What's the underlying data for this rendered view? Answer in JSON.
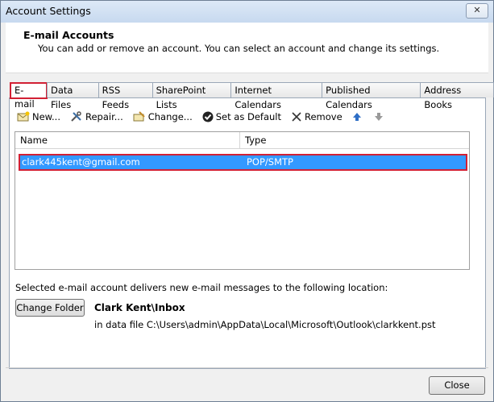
{
  "window": {
    "title": "Account Settings",
    "close_glyph": "✕"
  },
  "header": {
    "title": "E-mail Accounts",
    "subtitle": "You can add or remove an account. You can select an account and change its settings."
  },
  "tabs": [
    {
      "label": "E-mail"
    },
    {
      "label": "Data Files"
    },
    {
      "label": "RSS Feeds"
    },
    {
      "label": "SharePoint Lists"
    },
    {
      "label": "Internet Calendars"
    },
    {
      "label": "Published Calendars"
    },
    {
      "label": "Address Books"
    }
  ],
  "toolbar": {
    "new_label": "New...",
    "repair_label": "Repair...",
    "change_label": "Change...",
    "default_label": "Set as Default",
    "remove_label": "Remove"
  },
  "list": {
    "columns": {
      "name": "Name",
      "type": "Type"
    },
    "rows": [
      {
        "name": "clark445kent@gmail.com",
        "type": "POP/SMTP"
      }
    ]
  },
  "delivery": {
    "info": "Selected e-mail account delivers new e-mail messages to the following location:",
    "change_folder_label": "Change Folder",
    "location_name": "Clark Kent\\Inbox",
    "location_path": "in data file C:\\Users\\admin\\AppData\\Local\\Microsoft\\Outlook\\clarkkent.pst"
  },
  "footer": {
    "close_label": "Close"
  },
  "colors": {
    "selection": "#3399ff",
    "highlight_border": "#d22034"
  }
}
